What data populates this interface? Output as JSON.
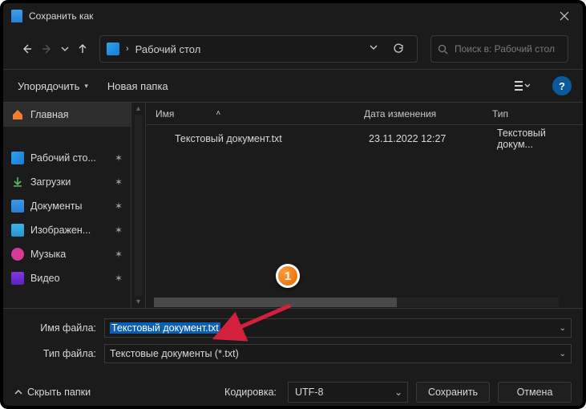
{
  "title": "Сохранить как",
  "nav": {
    "path_label": "Рабочий стол"
  },
  "search": {
    "placeholder": "Поиск в: Рабочий стол"
  },
  "toolbar": {
    "organize": "Упорядочить",
    "new_folder": "Новая папка"
  },
  "sidebar": {
    "home": "Главная",
    "desktop": "Рабочий сто...",
    "downloads": "Загрузки",
    "documents": "Документы",
    "pictures": "Изображен...",
    "music": "Музыка",
    "video": "Видео"
  },
  "columns": {
    "name": "Имя",
    "date": "Дата изменения",
    "type": "Тип"
  },
  "files": [
    {
      "name": "Текстовый документ.txt",
      "date": "23.11.2022 12:27",
      "type": "Текстовый докум..."
    }
  ],
  "form": {
    "filename_label": "Имя файла:",
    "filename_value": "Текстовый документ.txt",
    "filetype_label": "Тип файла:",
    "filetype_value": "Текстовые документы (*.txt)"
  },
  "footer": {
    "hide_folders": "Скрыть папки",
    "encoding_label": "Кодировка:",
    "encoding_value": "UTF-8",
    "save": "Сохранить",
    "cancel": "Отмена"
  },
  "annotation": {
    "badge": "1"
  }
}
